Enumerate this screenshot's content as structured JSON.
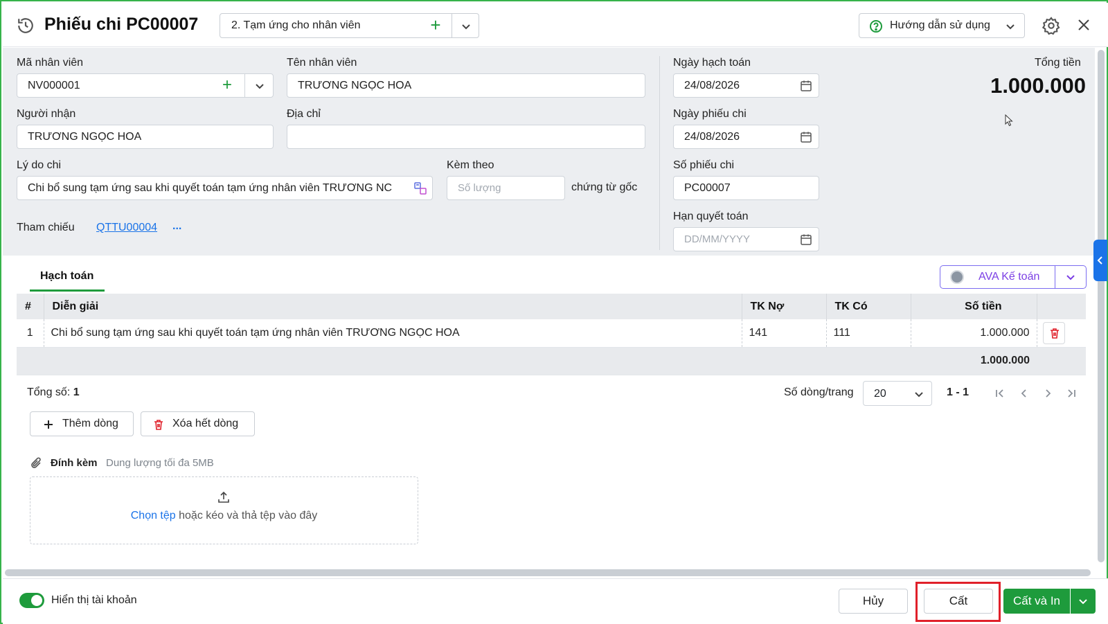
{
  "header": {
    "title": "Phiếu chi PC00007",
    "type_select": "2. Tạm ứng cho nhân viên",
    "guide_label": "Hướng dẫn sử dụng"
  },
  "form": {
    "employee_code_label": "Mã nhân viên",
    "employee_code": "NV000001",
    "employee_name_label": "Tên nhân viên",
    "employee_name": "TRƯƠNG NGỌC HOA",
    "receiver_label": "Người nhận",
    "receiver": "TRƯƠNG NGỌC HOA",
    "address_label": "Địa chỉ",
    "address": "",
    "reason_label": "Lý do chi",
    "reason": "Chi bổ sung tạm ứng sau khi quyết toán tạm ứng nhân viên TRƯƠNG NC",
    "attach_label": "Kèm theo",
    "attach_placeholder": "Số lượng",
    "attach_suffix": "chứng từ gốc",
    "reference_label": "Tham chiếu",
    "reference_link": "QTTU00004",
    "reference_more": "...",
    "posting_date_label": "Ngày hạch toán",
    "posting_date": "24/08/2026",
    "voucher_date_label": "Ngày phiếu chi",
    "voucher_date": "24/08/2026",
    "voucher_no_label": "Số phiếu chi",
    "voucher_no": "PC00007",
    "due_label": "Hạn quyết toán",
    "due_placeholder": "DD/MM/YYYY",
    "total_label": "Tổng tiền",
    "total_value": "1.000.000"
  },
  "panel": {
    "tab": "Hạch toán",
    "ava_label": "AVA Kế toán",
    "columns": [
      "#",
      "Diễn giải",
      "TK Nợ",
      "TK Có",
      "Số tiền"
    ],
    "rows": [
      {
        "no": "1",
        "desc": "Chi bổ sung tạm ứng sau khi quyết toán tạm ứng nhân viên TRƯƠNG NGỌC HOA",
        "debit": "141",
        "credit": "111",
        "amount": "1.000.000"
      }
    ],
    "sum_amount": "1.000.000",
    "count_label": "Tổng số:",
    "count_value": "1",
    "rows_per_page_label": "Số dòng/trang",
    "rows_per_page": "20",
    "range": "1 - 1",
    "add_row": "Thêm dòng",
    "delete_all": "Xóa hết dòng",
    "attachment_label": "Đính kèm",
    "attachment_hint": "Dung lượng tối đa 5MB",
    "choose_file": "Chọn tệp",
    "drop_text": " hoặc kéo và thả tệp vào đây"
  },
  "footer": {
    "toggle_label": "Hiển thị tài khoản",
    "cancel": "Hủy",
    "save": "Cất",
    "save_print": "Cất và In"
  },
  "colors": {
    "accent_green": "#1e9b3c",
    "link_blue": "#1a73e8",
    "ava_purple": "#7b3fe4",
    "highlight_red": "#e0202a"
  }
}
